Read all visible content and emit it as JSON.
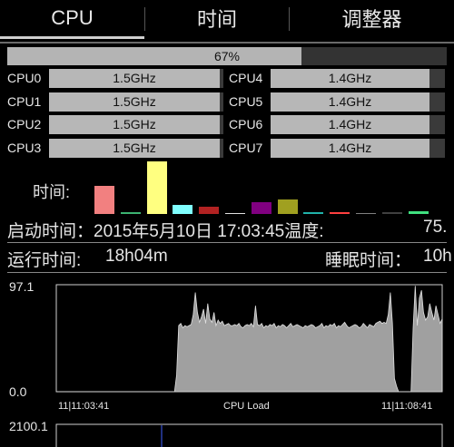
{
  "tabs": [
    {
      "label": "CPU"
    },
    {
      "label": "时间"
    },
    {
      "label": "调整器"
    }
  ],
  "overall": {
    "label": "67%",
    "fraction": 0.67
  },
  "cores": [
    {
      "name": "CPU0",
      "freq": "1.5GHz",
      "level": 0.98
    },
    {
      "name": "CPU1",
      "freq": "1.5GHz",
      "level": 0.98
    },
    {
      "name": "CPU2",
      "freq": "1.5GHz",
      "level": 0.98
    },
    {
      "name": "CPU3",
      "freq": "1.5GHz",
      "level": 0.98
    },
    {
      "name": "CPU4",
      "freq": "1.4GHz",
      "level": 0.91
    },
    {
      "name": "CPU5",
      "freq": "1.4GHz",
      "level": 0.91
    },
    {
      "name": "CPU6",
      "freq": "1.4GHz",
      "level": 0.91
    },
    {
      "name": "CPU7",
      "freq": "1.4GHz",
      "level": 0.91
    }
  ],
  "time_section": {
    "label": "时间:",
    "bar_colors": [
      "#f28080",
      "#3cb371",
      "#ffff80",
      "#80ffff",
      "#b22222",
      "#e0e0e0",
      "#800080",
      "#a0a020",
      "#20b2aa",
      "#ff4040",
      "#808080",
      "#404040",
      "#40e080"
    ],
    "bar_values": [
      0.52,
      0.03,
      0.96,
      0.17,
      0.13,
      0.0,
      0.22,
      0.27,
      0.03,
      0.03,
      0.02,
      0.03,
      0.05
    ]
  },
  "info": {
    "boot_label": "启动时间：",
    "boot_value": "2015年5月10日 17:03:45",
    "temp_label": "温度:",
    "temp_value": "75.",
    "uptime_label": "运行时间:",
    "uptime_value": "18h04m",
    "sleep_label": "睡眠时间：",
    "sleep_value": "10h"
  },
  "chart_data": [
    {
      "type": "area",
      "title": "CPU Load",
      "ylim": [
        0.0,
        97.1
      ],
      "y_tick_labels": [
        "97.1",
        "0.0"
      ],
      "x_tick_labels": [
        "11|11:03:41",
        "11|11:08:41"
      ],
      "color": "#a0a0a0",
      "values": [
        0,
        0,
        0,
        0,
        0,
        0,
        0,
        0,
        0,
        0,
        0,
        0,
        0,
        0,
        0,
        0,
        0,
        0,
        0,
        0,
        0,
        0,
        0,
        0,
        0,
        0,
        0,
        0,
        0,
        0,
        0,
        0,
        0,
        0,
        0,
        0,
        0,
        0,
        0,
        0,
        0,
        0,
        0,
        0,
        0,
        0,
        0,
        0,
        0,
        0,
        0,
        0,
        0,
        0,
        0,
        0,
        0,
        0,
        15,
        60,
        62,
        58,
        60,
        59,
        60,
        61,
        70,
        90,
        72,
        63,
        68,
        75,
        62,
        80,
        66,
        63,
        72,
        60,
        65,
        62,
        64,
        60,
        61,
        62,
        60,
        60,
        61,
        60,
        62,
        59,
        58,
        60,
        61,
        60,
        62,
        59,
        78,
        61,
        60,
        62,
        58,
        60,
        59,
        61,
        60,
        62,
        58,
        60,
        59,
        61,
        60,
        58,
        60,
        62,
        59,
        60,
        61,
        60,
        59,
        58,
        60,
        59,
        60,
        61,
        60,
        58,
        59,
        60,
        62,
        58,
        60,
        59,
        61,
        60,
        62,
        58,
        60,
        59,
        61,
        63,
        60,
        58,
        59,
        60,
        61,
        60,
        58,
        59,
        62,
        60,
        58,
        61,
        60,
        59,
        62,
        63,
        64,
        62,
        63,
        62,
        70,
        90,
        62,
        12,
        5,
        0,
        0,
        0,
        0,
        0,
        0,
        0,
        58,
        96,
        60,
        85,
        92,
        72,
        65,
        68,
        80,
        72,
        65,
        78,
        70,
        62,
        66
      ]
    },
    {
      "type": "line",
      "y_tick_labels": [
        "2100.1"
      ]
    }
  ]
}
